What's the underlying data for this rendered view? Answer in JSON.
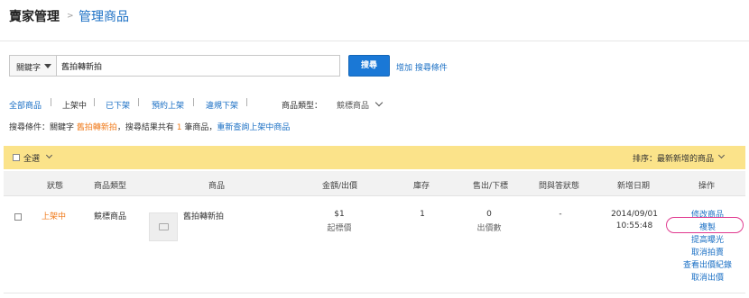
{
  "header": {
    "title": "賣家管理",
    "separator": ">",
    "subtitle": "管理商品"
  },
  "search": {
    "keyword_select": "關鍵字",
    "input_value": "舊拍轉新拍",
    "button_label": "搜尋",
    "add_conditions": "增加 搜尋條件"
  },
  "filters": {
    "tabs": [
      "全部商品",
      "上架中",
      "已下架",
      "預約上架",
      "違規下架"
    ],
    "type_label": "商品類型：",
    "type_value": "競標商品"
  },
  "conditions": {
    "prefix": "搜尋條件：關鍵字",
    "keyword": "舊拍轉新拍",
    "middle": "，搜尋結果共有",
    "count": "1",
    "suffix": "筆商品，",
    "requery_link": "重新查詢上架中商品"
  },
  "toolbar": {
    "select_all": "全選",
    "sort_label": "排序：最新新增的商品"
  },
  "table": {
    "headers": [
      "狀態",
      "商品類型",
      "商品",
      "金額/出價",
      "庫存",
      "售出/下標",
      "問與答狀態",
      "新增日期",
      "操作"
    ],
    "rows": [
      {
        "status": "上架中",
        "type": "競標商品",
        "product": "舊拍轉新拍",
        "price": "$1",
        "price_sub": "起標價",
        "stock": "1",
        "sold": "0",
        "sold_sub": "出價數",
        "qa": "-",
        "date": "2014/09/01",
        "time": "10:55:48",
        "actions": [
          "修改商品",
          "複製",
          "提高曝光",
          "取消拍賣",
          "查看出價紀錄",
          "取消出價"
        ]
      }
    ]
  },
  "colors": {
    "link": "#1a6fc4",
    "status_orange": "#f07a1a",
    "toolbar_yellow": "#fbe38a",
    "button_blue": "#1a78d6",
    "highlight_ring": "#e0388e"
  }
}
